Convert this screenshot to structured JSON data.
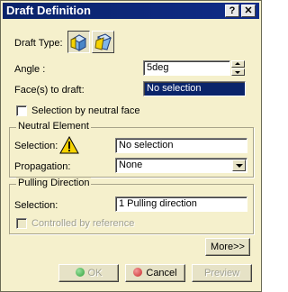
{
  "window": {
    "title": "Draft Definition",
    "help_label": "?",
    "close_label": "✕"
  },
  "draft_type": {
    "label": "Draft Type:"
  },
  "angle": {
    "label": "Angle :",
    "value": "5deg"
  },
  "faces": {
    "label": "Face(s) to draft:",
    "value": "No selection"
  },
  "neutral_face_checkbox": {
    "label": "Selection by neutral face",
    "checked": false
  },
  "neutral_element": {
    "title": "Neutral Element",
    "selection_label": "Selection:",
    "selection_value": "No selection",
    "propagation_label": "Propagation:",
    "propagation_value": "None"
  },
  "pulling_direction": {
    "title": "Pulling Direction",
    "selection_label": "Selection:",
    "selection_value": "1 Pulling direction",
    "controlled_label": "Controlled by reference"
  },
  "buttons": {
    "more": "More>>",
    "ok": "OK",
    "cancel": "Cancel",
    "preview": "Preview"
  },
  "colors": {
    "title_bar": "#0a246a",
    "background": "#f5f0cc",
    "selection": "#0a246a",
    "ok_dot": "#2e9e3a",
    "cancel_dot": "#c8282a",
    "warning": "#f6d300"
  }
}
